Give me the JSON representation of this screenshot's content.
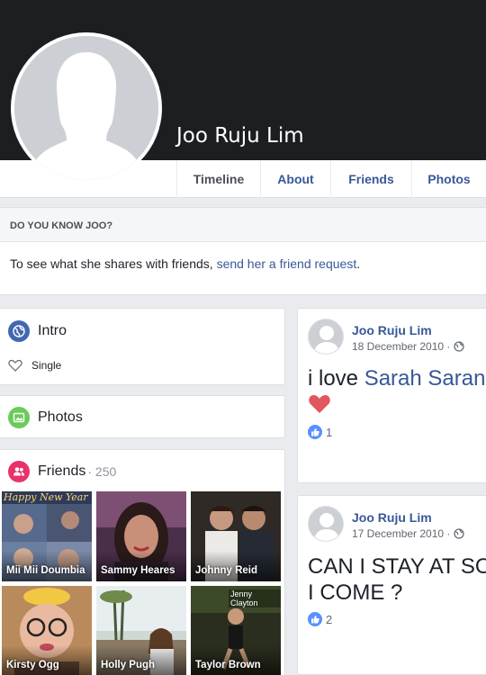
{
  "profile": {
    "name": "Joo Ruju Lim"
  },
  "tabs": [
    {
      "label": "Timeline"
    },
    {
      "label": "About"
    },
    {
      "label": "Friends"
    },
    {
      "label": "Photos"
    }
  ],
  "know_box": {
    "heading": "DO YOU KNOW JOO?",
    "text": "To see what she shares with friends, ",
    "link": "send her a friend request",
    "text_end": "."
  },
  "intro": {
    "title": "Intro",
    "relationship": "Single"
  },
  "photos": {
    "title": "Photos"
  },
  "friends": {
    "title": "Friends",
    "count": "· 250",
    "items": [
      {
        "name": "Mii Mii Doumbia"
      },
      {
        "name": "Sammy Heares"
      },
      {
        "name": "Johnny Reid"
      },
      {
        "name": "Kirsty Ogg"
      },
      {
        "name": "Holly Pugh"
      },
      {
        "name": "Taylor Brown"
      }
    ],
    "tile_overlays": [
      "Happy New Year",
      "Jenny Clayton"
    ]
  },
  "posts": [
    {
      "author": "Joo Ruju Lim",
      "date": "18 December 2010 ·",
      "text_prefix": "i love ",
      "text_link": "Sarah Sarang",
      "likes": "1"
    },
    {
      "author": "Joo Ruju Lim",
      "date": "17 December 2010 ·",
      "text_line1": "CAN I STAY AT SOM",
      "text_line2": "I COME ?",
      "likes": "2"
    }
  ],
  "colors": {
    "link": "#385898",
    "cover": "#1c1e21",
    "intro_icon": "#4267b2",
    "photos_icon": "#6bcb5a",
    "friends_icon": "#e9326a",
    "like_badge": "#5890ff",
    "heart": "#e0575d"
  },
  "icons": [
    "globe-icon",
    "heart-outline-icon",
    "photos-icon",
    "friends-icon",
    "like-icon",
    "public-globe-icon"
  ]
}
